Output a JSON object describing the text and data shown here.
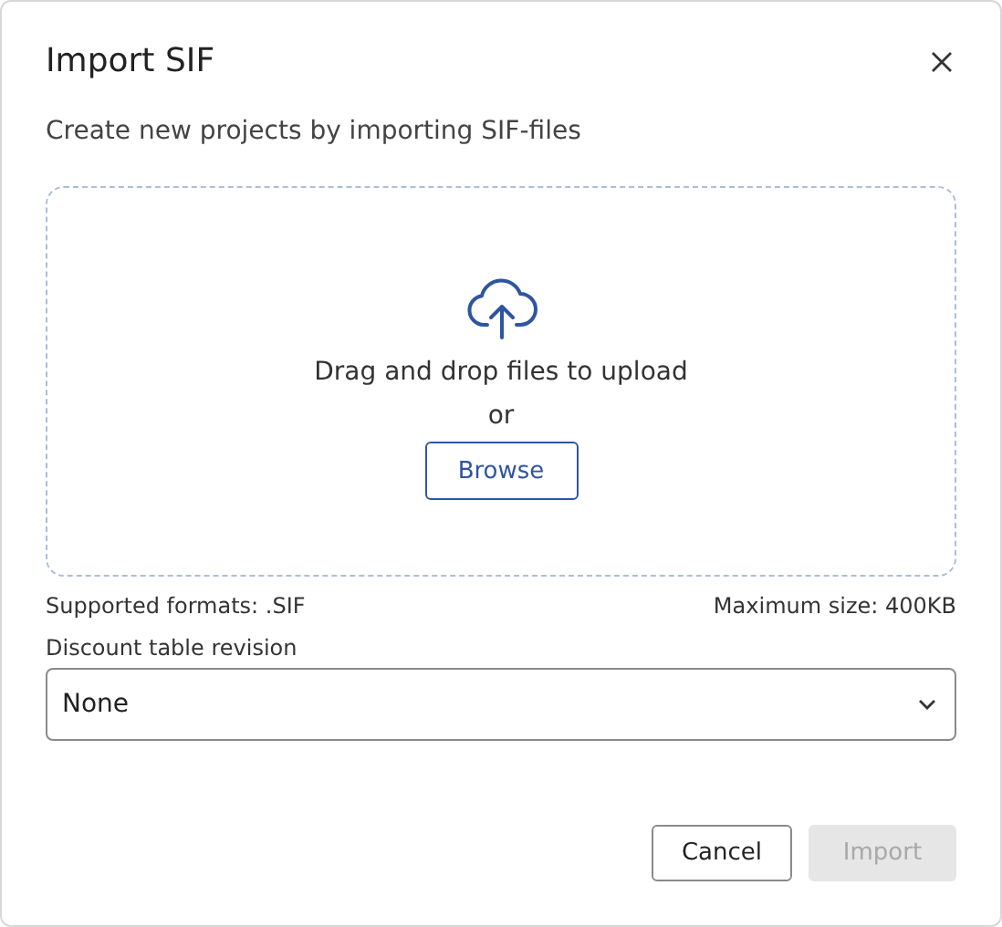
{
  "dialog": {
    "title": "Import SIF",
    "subtitle": "Create new projects by importing SIF-files"
  },
  "dropzone": {
    "text": "Drag and drop files to upload",
    "separator": "or",
    "browse": "Browse"
  },
  "hints": {
    "formats": "Supported formats: .SIF",
    "max_size": "Maximum size: 400KB"
  },
  "select": {
    "label": "Discount table revision",
    "value": "None"
  },
  "buttons": [
    {
      "label": "Cancel",
      "kind": "secondary",
      "disabled": false
    },
    {
      "label": "Import",
      "kind": "primary",
      "disabled": true
    }
  ]
}
